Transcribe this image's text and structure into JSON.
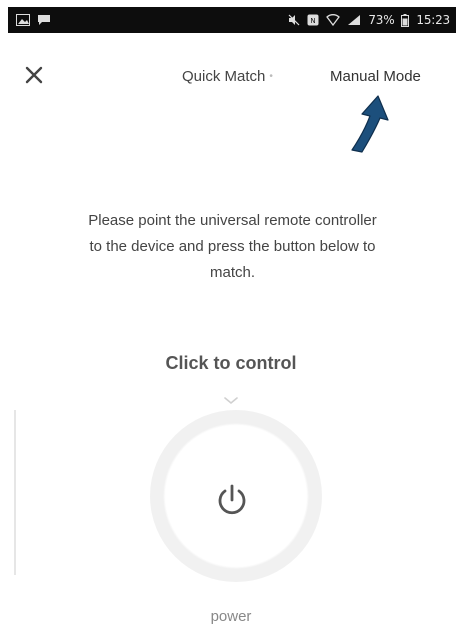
{
  "status_bar": {
    "battery": "73%",
    "time": "15:23",
    "icons": [
      "image-icon",
      "message-icon",
      "mute-icon",
      "nfc-icon",
      "wifi-icon",
      "signal-icon",
      "battery-icon"
    ]
  },
  "header": {
    "close_icon": "close-icon",
    "tab_quick_match": "Quick Match",
    "tab_quick_match_dot": "•",
    "tab_manual_mode": "Manual Mode",
    "annotation": "arrow-pointing-to-manual-mode"
  },
  "main": {
    "instruction": "Please point the universal remote controller to the device and press the button below to match.",
    "control_title": "Click to control",
    "power_icon": "power-icon",
    "power_label": "power"
  },
  "colors": {
    "status_bar_bg": "#0d0d0d",
    "annotation_arrow": "#1c4f7c",
    "text": "#444444"
  }
}
